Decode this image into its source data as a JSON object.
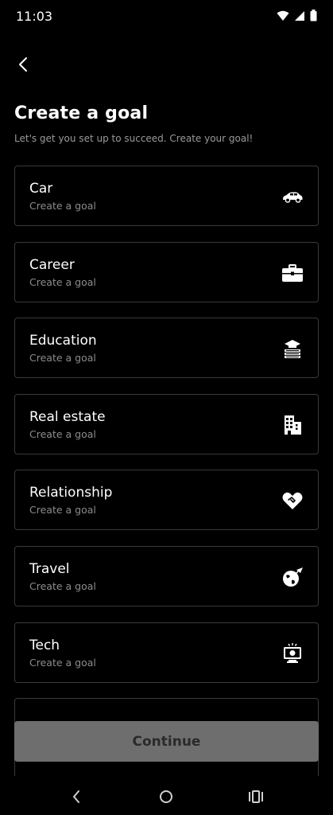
{
  "status": {
    "time": "11:03"
  },
  "header": {
    "title": "Create a goal",
    "subtitle": "Let's get you set up to succeed. Create your goal!"
  },
  "goals": [
    {
      "name": "Car",
      "subtitle": "Create a goal",
      "icon": "car-icon"
    },
    {
      "name": "Career",
      "subtitle": "Create a goal",
      "icon": "briefcase-icon"
    },
    {
      "name": "Education",
      "subtitle": "Create a goal",
      "icon": "books-icon"
    },
    {
      "name": "Real estate",
      "subtitle": "Create a goal",
      "icon": "building-icon"
    },
    {
      "name": "Relationship",
      "subtitle": "Create a goal",
      "icon": "heart-handshake-icon"
    },
    {
      "name": "Travel",
      "subtitle": "Create a goal",
      "icon": "globe-plane-icon"
    },
    {
      "name": "Tech",
      "subtitle": "Create a goal",
      "icon": "computer-icon"
    }
  ],
  "footer": {
    "continue_label": "Continue"
  },
  "colors": {
    "background": "#000000",
    "card_border": "#3a3a3a",
    "button_disabled": "#6e6e6e"
  }
}
